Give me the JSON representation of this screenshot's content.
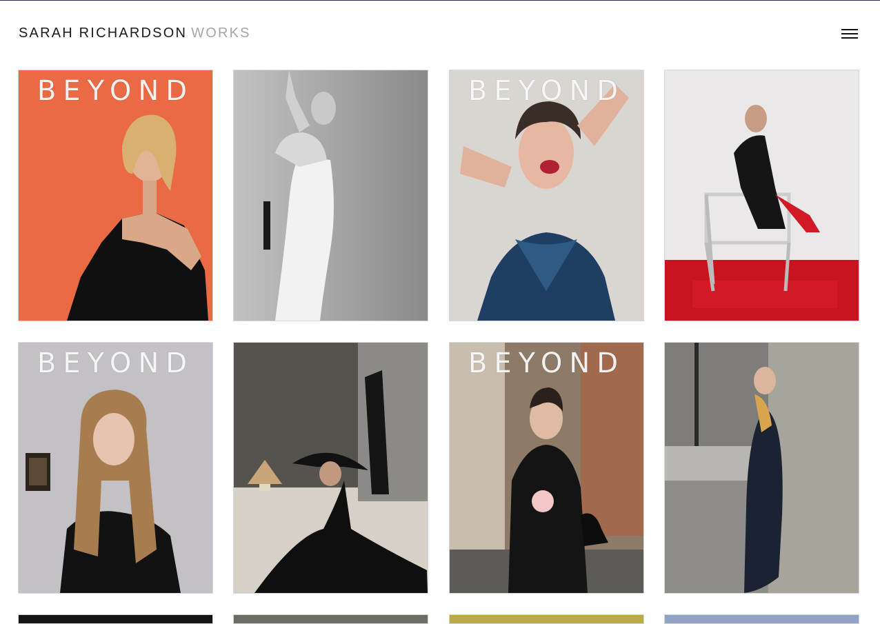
{
  "header": {
    "name": "SARAH RICHARDSON",
    "section": "WORKS",
    "menu_icon": "hamburger-menu-icon"
  },
  "tiles": [
    {
      "label": "BEYOND",
      "bg": "#e8643f"
    },
    {
      "label": "",
      "bg": "#9a9a9a"
    },
    {
      "label": "BEYOND",
      "bg": "#d9d6d2"
    },
    {
      "label": "",
      "bg": "#e9e6e8"
    },
    {
      "label": "BEYOND",
      "bg": "#c3c1c5"
    },
    {
      "label": "",
      "bg": "#b8b4ae"
    },
    {
      "label": "BEYOND",
      "bg": "#8d7a67"
    },
    {
      "label": "",
      "bg": "#a3a3a1"
    },
    {
      "label": "",
      "bg": "#141414"
    },
    {
      "label": "",
      "bg": "#6d6e62"
    },
    {
      "label": "",
      "bg": "#b8a94a"
    },
    {
      "label": "",
      "bg": "#8fa4c4"
    }
  ]
}
